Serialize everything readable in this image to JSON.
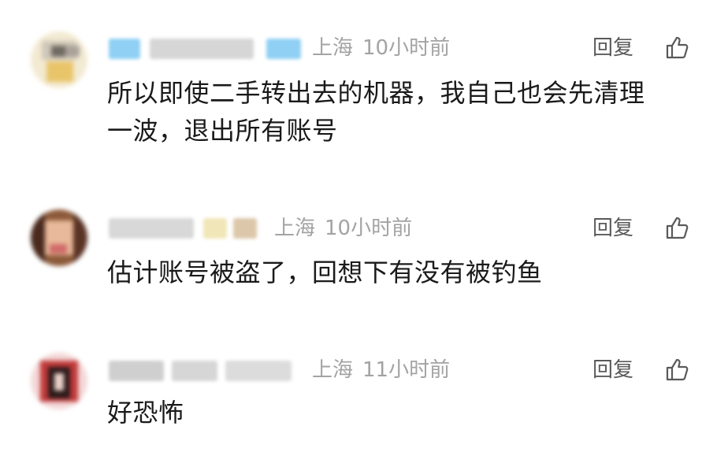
{
  "comments": [
    {
      "location": "上海",
      "time": "10小时前",
      "reply_label": "回复",
      "like_icon": "thumbs-up-icon",
      "text_lines": [
        "所以即使二手转出去的机器，我自己也会先清理",
        "一波，退出所有账号"
      ]
    },
    {
      "location": "上海",
      "time": "10小时前",
      "reply_label": "回复",
      "like_icon": "thumbs-up-icon",
      "text_lines": [
        "估计账号被盗了，回想下有没有被钓鱼"
      ]
    },
    {
      "location": "上海",
      "time": "11小时前",
      "reply_label": "回复",
      "like_icon": "thumbs-up-icon",
      "text_lines": [
        "好恐怖"
      ]
    }
  ],
  "colors": {
    "meta_gray": "#a3a3a3",
    "reply_gray": "#5a5a5a",
    "text_dark": "#1a1a1a",
    "background": "#ffffff"
  }
}
